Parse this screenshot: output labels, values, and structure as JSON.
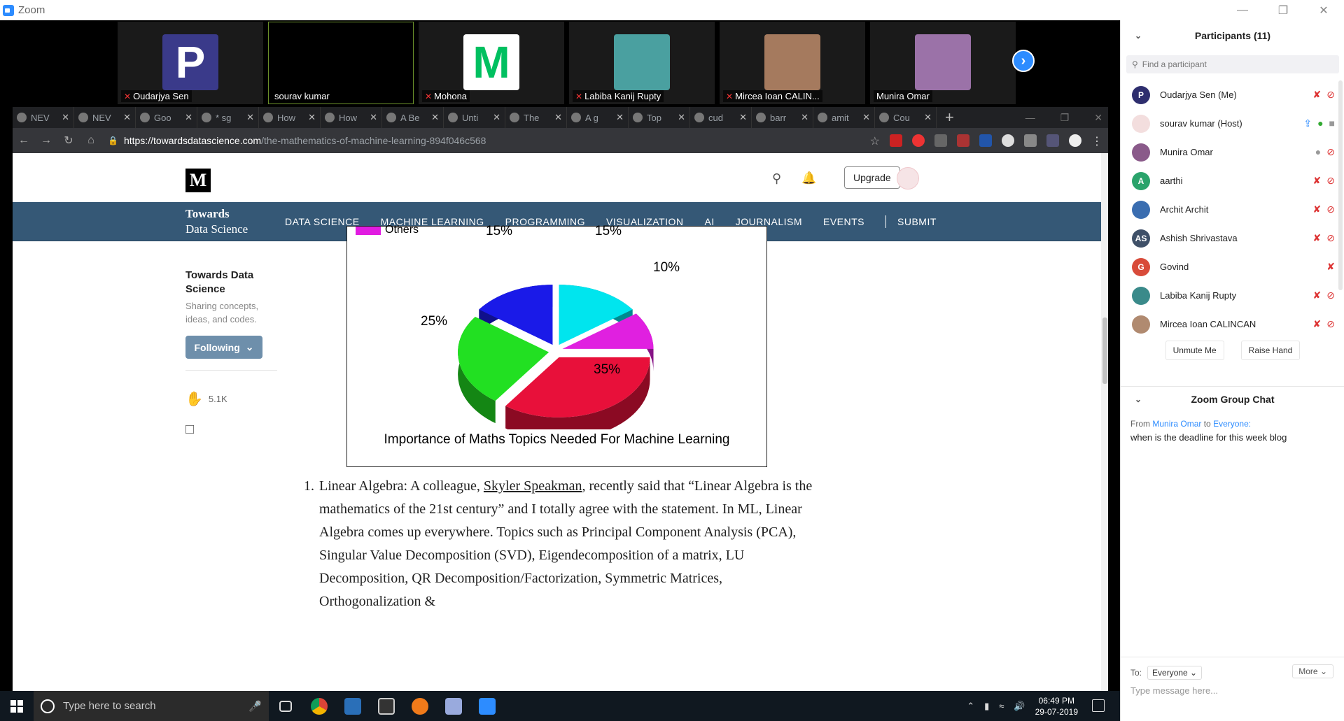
{
  "zoom": {
    "title": "Zoom",
    "video_tiles": [
      {
        "name": "Oudarjya Sen",
        "muted": true,
        "avatar_color": "#3a3a8a",
        "avatar_text": "P"
      },
      {
        "name": "sourav kumar",
        "muted": false,
        "avatar_color": "#000000",
        "avatar_text": ""
      },
      {
        "name": "Mohona",
        "muted": true,
        "avatar_color": "#ffffff",
        "avatar_text": "M"
      },
      {
        "name": "Labiba Kanij Rupty",
        "muted": true,
        "avatar_color": "#4aa0a0",
        "avatar_text": ""
      },
      {
        "name": "Mircea Ioan CALIN...",
        "muted": true,
        "avatar_color": "#a57a5e",
        "avatar_text": ""
      },
      {
        "name": "Munira Omar",
        "muted": false,
        "avatar_color": "#9b72a8",
        "avatar_text": ""
      }
    ]
  },
  "browser": {
    "tabs": [
      "NEV",
      "NEV",
      "Goo",
      "* sg",
      "How",
      "How",
      "A Be",
      "Unti",
      "The",
      "A g",
      "Top",
      "cud",
      "barr",
      "amit",
      "Cou"
    ],
    "url_host": "https://towardsdatascience.com",
    "url_path": "/the-mathematics-of-machine-learning-894f046c568"
  },
  "medium": {
    "logo": "M",
    "upgrade_label": "Upgrade",
    "brand_line1": "Towards",
    "brand_line2": "Data Science",
    "nav": [
      "DATA SCIENCE",
      "MACHINE LEARNING",
      "PROGRAMMING",
      "VISUALIZATION",
      "AI",
      "JOURNALISM",
      "EVENTS",
      "SUBMIT"
    ],
    "sidebar": {
      "title": "Towards Data Science",
      "desc": "Sharing concepts, ideas, and codes.",
      "follow_label": "Following",
      "claps": "5.1K"
    }
  },
  "chart_data": {
    "type": "pie",
    "title": "Importance of Maths Topics Needed For Machine Learning",
    "legend_visible": [
      "Others"
    ],
    "slices": [
      {
        "label": "15%",
        "value": 15,
        "color": "#00e5ee"
      },
      {
        "label": "10%",
        "value": 10,
        "color": "#e020e0"
      },
      {
        "label": "35%",
        "value": 35,
        "color": "#e8103a"
      },
      {
        "label": "25%",
        "value": 25,
        "color": "#22e022"
      },
      {
        "label": "15%",
        "value": 15,
        "color": "#1a1ae8"
      }
    ]
  },
  "article": {
    "item_number": "1.",
    "lead": "Linear Algebra: A colleague, ",
    "link": "Skyler Speakman",
    "rest": ", recently said that “Linear Algebra is the mathematics of the 21st century” and I totally agree with the statement. In ML, Linear Algebra comes up everywhere. Topics such as Principal Component Analysis (PCA), Singular Value Decomposition (SVD), Eigendecomposition of a matrix, LU Decomposition, QR Decomposition/Factorization, Symmetric Matrices, Orthogonalization &"
  },
  "taskbar": {
    "search_placeholder": "Type here to search",
    "time": "06:49 PM",
    "date": "29-07-2019"
  },
  "participants": {
    "header": "Participants (11)",
    "find_placeholder": "Find a participant",
    "list": [
      {
        "name": "Oudarjya Sen (Me)",
        "initials": "P",
        "color": "#2e2e6e",
        "mic": "muted",
        "video": "off"
      },
      {
        "name": "sourav kumar (Host)",
        "initials": "",
        "color": "#f3dede",
        "mic": "on",
        "video": "on",
        "share": true
      },
      {
        "name": "Munira Omar",
        "initials": "",
        "color": "#8a5a8a",
        "mic": "idle",
        "video": "off"
      },
      {
        "name": "aarthi",
        "initials": "A",
        "color": "#2aa36b",
        "mic": "muted",
        "video": "off"
      },
      {
        "name": "Archit Archit",
        "initials": "",
        "color": "#3a6db0",
        "mic": "muted",
        "video": "off"
      },
      {
        "name": "Ashish Shrivastava",
        "initials": "AS",
        "color": "#3f5068",
        "mic": "muted",
        "video": "off"
      },
      {
        "name": "Govind",
        "initials": "G",
        "color": "#d84b3a",
        "mic": "muted",
        "video": ""
      },
      {
        "name": "Labiba Kanij Rupty",
        "initials": "",
        "color": "#3a8a8a",
        "mic": "muted",
        "video": "off"
      },
      {
        "name": "Mircea Ioan CALINCAN",
        "initials": "",
        "color": "#b08a70",
        "mic": "muted",
        "video": "off"
      }
    ],
    "unmute_label": "Unmute Me",
    "raise_label": "Raise Hand"
  },
  "chat": {
    "header": "Zoom Group Chat",
    "from_label": "From",
    "from_name": "Munira Omar",
    "to_label": "to",
    "to_name": "Everyone:",
    "message": "when is the deadline for this week blog",
    "to_prefix": "To:",
    "to_select": "Everyone",
    "more": "More",
    "input_placeholder": "Type message here..."
  }
}
